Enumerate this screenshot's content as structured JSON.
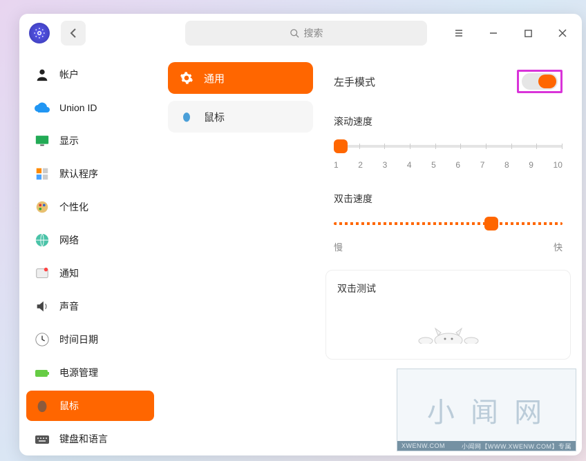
{
  "search": {
    "placeholder": "搜索"
  },
  "sidebar": {
    "items": [
      {
        "label": "帐户"
      },
      {
        "label": "Union ID"
      },
      {
        "label": "显示"
      },
      {
        "label": "默认程序"
      },
      {
        "label": "个性化"
      },
      {
        "label": "网络"
      },
      {
        "label": "通知"
      },
      {
        "label": "声音"
      },
      {
        "label": "时间日期"
      },
      {
        "label": "电源管理"
      },
      {
        "label": "鼠标"
      },
      {
        "label": "键盘和语言"
      }
    ],
    "active_index": 10
  },
  "submenu": {
    "items": [
      {
        "label": "通用"
      },
      {
        "label": "鼠标"
      }
    ],
    "active_index": 0
  },
  "settings": {
    "left_hand": {
      "label": "左手模式",
      "enabled": true
    },
    "scroll": {
      "label": "滚动速度",
      "ticks": [
        "1",
        "2",
        "3",
        "4",
        "5",
        "6",
        "7",
        "8",
        "9",
        "10"
      ],
      "value_index": 0
    },
    "doubleclick": {
      "label": "双击速度",
      "value_percent": 68,
      "min_label": "慢",
      "max_label": "快"
    },
    "test": {
      "label": "双击测试"
    }
  },
  "watermark": {
    "text": "小 闻 网",
    "footer_left": "XWENW.COM",
    "footer_right": "小闻网【WWW.XWENW.COM】专属"
  }
}
